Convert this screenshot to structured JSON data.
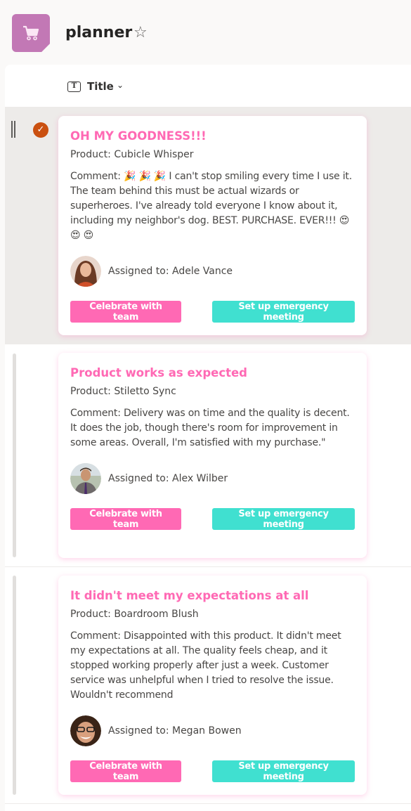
{
  "app": {
    "title": "planner",
    "logo_icon": "shopping-cart-icon",
    "favorite_icon": "star-outline-icon",
    "brand_color": "#c278b5"
  },
  "list": {
    "column_header": {
      "label": "Title",
      "icon": "text-field-icon",
      "sort_icon": "chevron-down-icon"
    },
    "accent_colors": {
      "title": "#ff69b4",
      "celebrate_button": "#ff69b4",
      "emergency_button": "#40e0d0",
      "selected_check": "#ca5010"
    },
    "items": [
      {
        "selected": true,
        "title": "OH MY GOODNESS!!!",
        "product": "Product: Cubicle Whisper",
        "comment": "Comment: 🎉 🎉 🎉 I can't stop smiling every time I use it. The team behind this must be actual wizards or superheroes. I've already told everyone I know about it, including my neighbor's dog. BEST. PURCHASE. EVER!!! 😍 😍 😍",
        "assigned_to": "Assigned to: Adele Vance",
        "celebrate_label": "Celebrate with team",
        "emergency_label": "Set up emergency meeting"
      },
      {
        "selected": false,
        "title": "Product works as expected",
        "product": "Product: Stiletto Sync",
        "comment": "Comment: Delivery was on time and the quality is decent. It does the job, though there's room for improvement in some areas. Overall, I'm satisfied with my purchase.\"",
        "assigned_to": "Assigned to: Alex Wilber",
        "celebrate_label": "Celebrate with team",
        "emergency_label": "Set up emergency meeting"
      },
      {
        "selected": false,
        "title": "It didn't meet my expectations at all",
        "product": "Product: Boardroom Blush",
        "comment": "Comment: Disappointed with this product. It didn't meet my expectations at all. The quality feels cheap, and it stopped working properly after just a week. Customer service was unhelpful when I tried to resolve the issue. Wouldn't recommend",
        "assigned_to": "Assigned to: Megan Bowen",
        "celebrate_label": "Celebrate with team",
        "emergency_label": "Set up emergency meeting"
      }
    ]
  }
}
